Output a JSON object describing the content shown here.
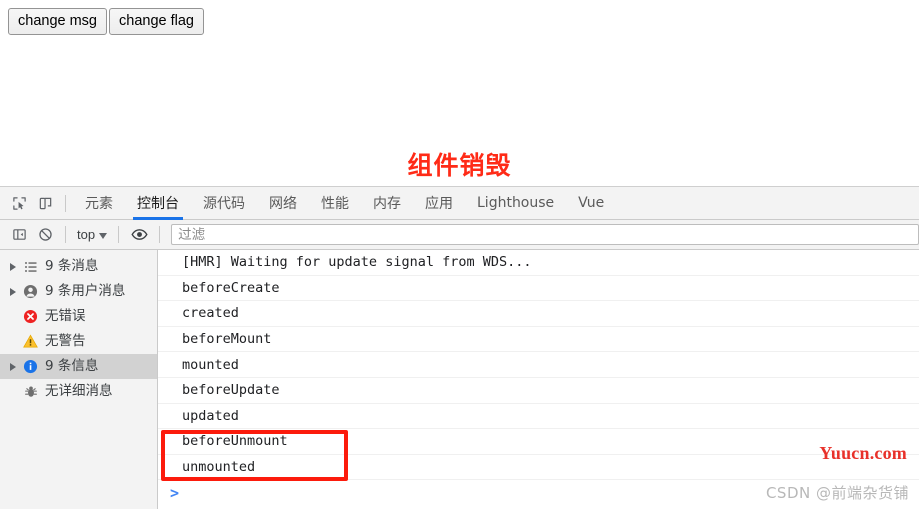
{
  "page": {
    "buttons": [
      {
        "label": "change msg",
        "name": "change-msg-button"
      },
      {
        "label": "change flag",
        "name": "change-flag-button"
      }
    ],
    "destroy_title": "组件销毁",
    "destroy_title_color": "#ff2b17"
  },
  "devtools": {
    "tabs": [
      {
        "label": "元素",
        "active": false
      },
      {
        "label": "控制台",
        "active": true
      },
      {
        "label": "源代码",
        "active": false
      },
      {
        "label": "网络",
        "active": false
      },
      {
        "label": "性能",
        "active": false
      },
      {
        "label": "内存",
        "active": false
      },
      {
        "label": "应用",
        "active": false
      },
      {
        "label": "Lighthouse",
        "active": false
      },
      {
        "label": "Vue",
        "active": false
      }
    ],
    "active_tab_accent": "#1a73e8",
    "toolbar": {
      "context_label": "top",
      "filter_placeholder": "过滤",
      "filter_value": ""
    },
    "sidebar": {
      "items": [
        {
          "label": "9 条消息",
          "icon": "list-icon",
          "expandable": true,
          "selected": false
        },
        {
          "label": "9 条用户消息",
          "icon": "user-icon",
          "expandable": true,
          "selected": false
        },
        {
          "label": "无错误",
          "icon": "error-icon",
          "expandable": false,
          "selected": false
        },
        {
          "label": "无警告",
          "icon": "warning-icon",
          "expandable": false,
          "selected": false
        },
        {
          "label": "9 条信息",
          "icon": "info-icon",
          "expandable": true,
          "selected": true
        },
        {
          "label": "无详细消息",
          "icon": "verbose-bug-icon",
          "expandable": false,
          "selected": false
        }
      ]
    },
    "console": {
      "rows": [
        {
          "text": "[HMR] Waiting for update signal from WDS...",
          "highlighted": false
        },
        {
          "text": "beforeCreate",
          "highlighted": false
        },
        {
          "text": "created",
          "highlighted": false
        },
        {
          "text": "beforeMount",
          "highlighted": false
        },
        {
          "text": "mounted",
          "highlighted": false
        },
        {
          "text": "beforeUpdate",
          "highlighted": false
        },
        {
          "text": "updated",
          "highlighted": false
        },
        {
          "text": "beforeUnmount",
          "highlighted": true
        },
        {
          "text": "unmounted",
          "highlighted": true
        }
      ],
      "prompt_symbol": ">",
      "prompt_value": "",
      "highlight_box_color": "#fc1b0c"
    }
  },
  "watermarks": {
    "yuucn": "Yuucn.com",
    "csdn": "CSDN @前端杂货铺"
  }
}
